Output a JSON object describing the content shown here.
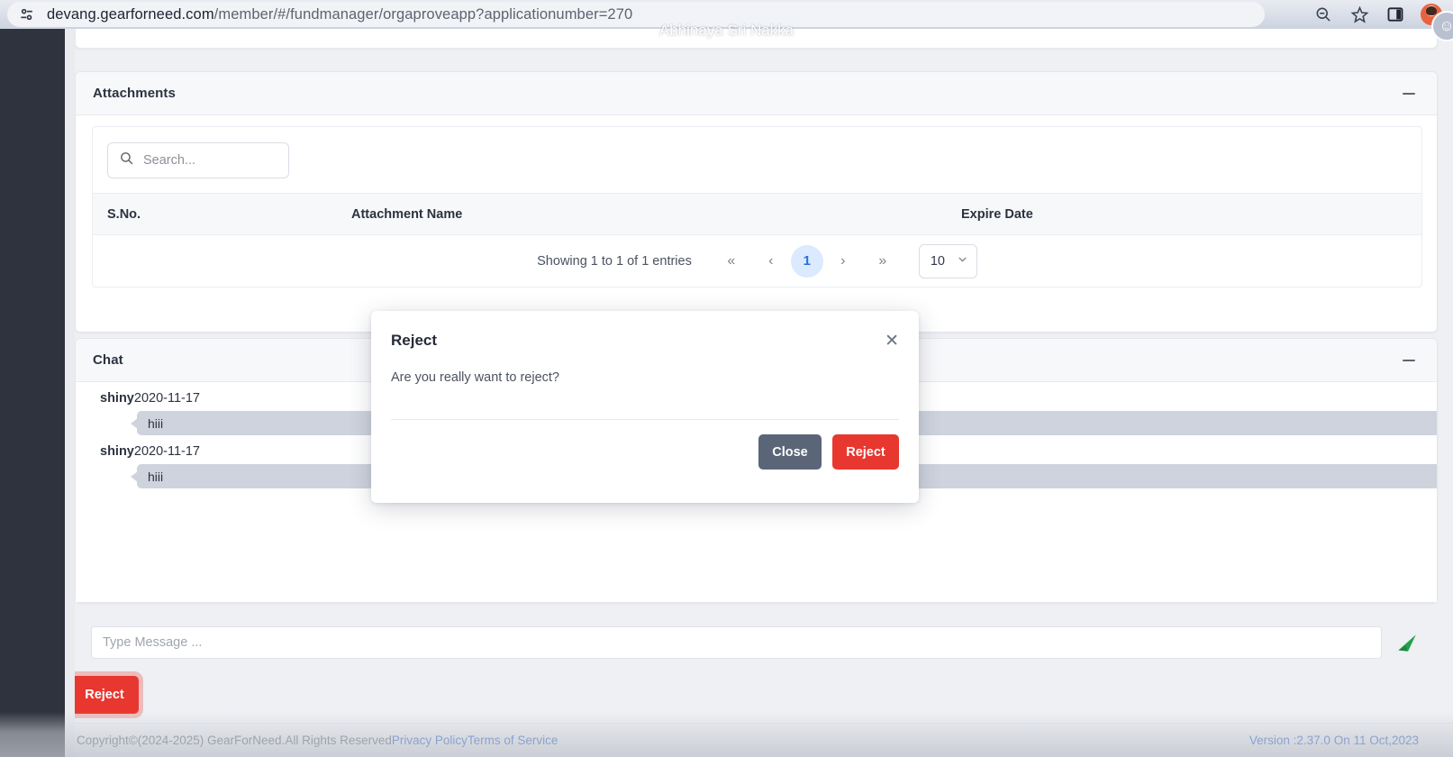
{
  "browser": {
    "url_prefix": "devang.gearforneed.com",
    "url_path": "/member/#/fundmanager/orgaproveapp?applicationumber=270",
    "url_full": "devang.gearforneed.com/member/#/fundmanager/orgaproveapp?applicationumber=270",
    "site_info_icon": "site-settings-icon",
    "zoom_out_icon": "zoom-out-icon",
    "bookmark_icon": "star-icon",
    "side_panel_icon": "side-panel-icon",
    "profile_icon": "avatar",
    "feedback_icon": "smiley-icon",
    "watermark": "Abhinaya Sri Nakka"
  },
  "attachments": {
    "title": "Attachments",
    "collapse_icon": "minus-icon",
    "search": {
      "value": "",
      "placeholder": "Search...",
      "icon": "search-icon"
    },
    "columns": [
      "S.No.",
      "Attachment Name",
      "Expire Date"
    ],
    "rows": [],
    "pagination": {
      "info": "Showing 1 to 1 of 1 entries",
      "first": "«",
      "prev": "‹",
      "pages": [
        "1"
      ],
      "current_page": "1",
      "next": "›",
      "last": "»",
      "page_size": "10",
      "page_size_chevron": "chevron-down-icon"
    }
  },
  "chat": {
    "title": "Chat",
    "collapse_icon": "minus-icon",
    "messages": [
      {
        "author": "shiny",
        "date": "2020-11-17",
        "text": "hiii"
      },
      {
        "author": "shiny",
        "date": "2020-11-17",
        "text": "hiii"
      }
    ],
    "compose": {
      "value": "",
      "placeholder": "Type Message ...",
      "send_icon": "send-plane-icon"
    }
  },
  "actions": {
    "reject_label": "Reject"
  },
  "footer": {
    "copyright": "Copyright©(2024-2025) GearForNeed.All Rights Reserved",
    "privacy_policy": "Privacy Policy",
    "terms_of_service": "Terms of Service",
    "version": "Version :2.37.0 On 11 Oct,2023"
  },
  "modal": {
    "title": "Reject",
    "close_icon": "close-icon",
    "message": "Are you really want to reject?",
    "close_label": "Close",
    "confirm_label": "Reject"
  },
  "colors": {
    "danger": "#e8372f",
    "secondary": "#5a6678",
    "sidebar": "#2f333e",
    "link": "#2c62c8",
    "page_active_bg": "#dbeafe",
    "page_active_text": "#2a6fdb",
    "bubble": "#ced3dd",
    "send_icon": "#22a04a"
  }
}
